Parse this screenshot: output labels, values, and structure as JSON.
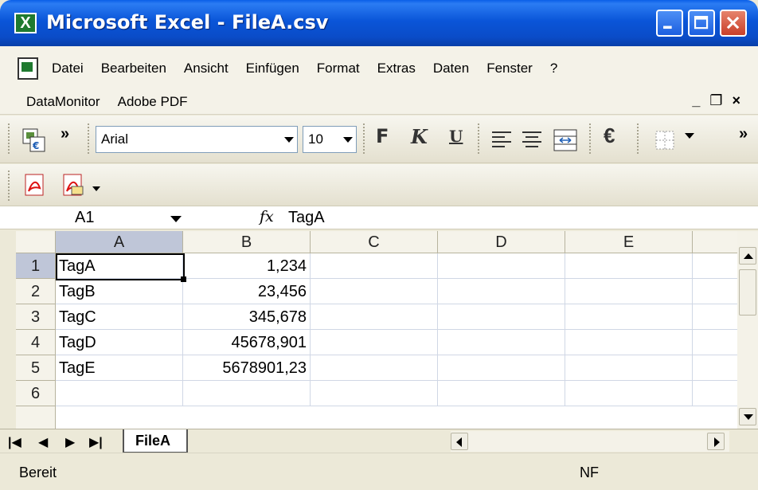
{
  "window": {
    "title": "Microsoft Excel - FileA.csv",
    "app_icon_letter": "X"
  },
  "menu": {
    "row1": [
      "Datei",
      "Bearbeiten",
      "Ansicht",
      "Einfügen",
      "Format",
      "Extras",
      "Daten",
      "Fenster",
      "?"
    ],
    "row2": [
      "DataMonitor",
      "Adobe PDF"
    ]
  },
  "toolbar": {
    "font_name": "Arial",
    "font_size": "10",
    "bold": "F",
    "italic": "K",
    "underline": "U",
    "currency": "€"
  },
  "formula_bar": {
    "name_box": "A1",
    "fx": "fx",
    "formula": "TagA"
  },
  "grid": {
    "columns": [
      "A",
      "B",
      "C",
      "D",
      "E"
    ],
    "rows": [
      {
        "num": "1",
        "a": "TagA",
        "b": "1,234"
      },
      {
        "num": "2",
        "a": "TagB",
        "b": "23,456"
      },
      {
        "num": "3",
        "a": "TagC",
        "b": "345,678"
      },
      {
        "num": "4",
        "a": "TagD",
        "b": "45678,901"
      },
      {
        "num": "5",
        "a": "TagE",
        "b": "5678901,23"
      },
      {
        "num": "6",
        "a": "",
        "b": ""
      }
    ]
  },
  "sheets": {
    "active": "FileA"
  },
  "status": {
    "text": "Bereit",
    "indicator": "NF"
  },
  "colors": {
    "title_bar": "#0a55d8",
    "selected_header": "#bfc6d8",
    "chrome": "#ece9d8"
  }
}
